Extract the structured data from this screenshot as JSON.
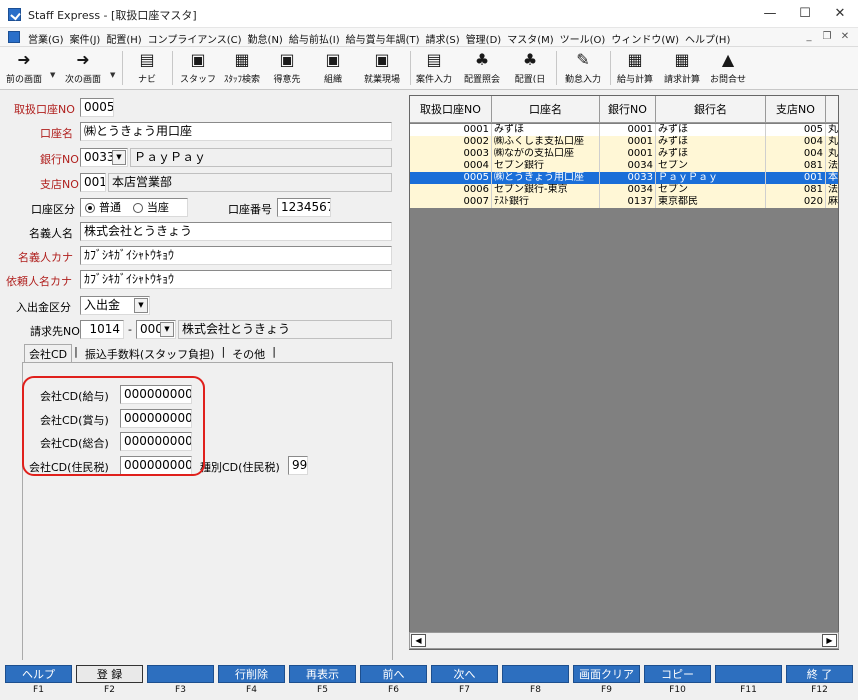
{
  "window": {
    "title": "Staff Express - [取扱口座マスタ]",
    "minimize": "—",
    "maximize": "☐",
    "close": "✕"
  },
  "menu": {
    "items": [
      "営業(G)",
      "案件(J)",
      "配置(H)",
      "コンプライアンス(C)",
      "勤怠(N)",
      "給与前払(I)",
      "給与賞与年調(T)",
      "請求(S)",
      "管理(D)",
      "マスタ(M)",
      "ツール(O)",
      "ウィンドウ(W)",
      "ヘルプ(H)"
    ],
    "mdi_minimize": "_",
    "mdi_restore": "❐",
    "mdi_close": "✕"
  },
  "toolbar": {
    "prev": "前の画面",
    "next": "次の画面",
    "navi": "ナビ",
    "staff": "スタッフ",
    "staff_search": "ｽﾀｯﾌ検索",
    "client": "得意先",
    "org": "組織",
    "workplace": "就業現場",
    "job_entry": "案件入力",
    "assign_inquiry": "配置照会",
    "assign_day": "配置(日",
    "attendance": "勤怠入力",
    "payroll": "給与計算",
    "billing": "請求計算",
    "inquiry": "お問合せ"
  },
  "form": {
    "account_no_label": "取扱口座NO",
    "account_no": "0005",
    "account_name_label": "口座名",
    "account_name": "㈱とうきょう用口座",
    "bank_no_label": "銀行NO",
    "bank_no": "0033",
    "bank_name": "ＰａｙＰａｙ",
    "branch_no_label": "支店NO",
    "branch_no": "001",
    "branch_name": "本店営業部",
    "account_type_label": "口座区分",
    "account_type_opt1": "普通",
    "account_type_opt2": "当座",
    "account_number_label": "口座番号",
    "account_number": "1234567",
    "holder_name_label": "名義人名",
    "holder_name": "株式会社とうきょう",
    "holder_kana_label": "名義人カナ",
    "holder_kana": "ｶﾌﾞｼｷｶﾞｲｼｬﾄｳｷｮｳ",
    "requester_kana_label": "依頼人名カナ",
    "requester_kana": "ｶﾌﾞｼｷｶﾞｲｼｬﾄｳｷｮｳ",
    "inout_label": "入出金区分",
    "inout_value": "入出金",
    "billing_to_label": "請求先NO",
    "billing_to_no": "1014",
    "billing_to_dash": "-",
    "billing_to_sub": "000",
    "billing_to_name": "株式会社とうきょう"
  },
  "tabs": {
    "tab1": "会社CD",
    "tab2": "振込手数料(スタッフ負担)",
    "tab3": "その他",
    "sep": "|"
  },
  "company_cd": {
    "salary_label": "会社CD(給与)",
    "salary": "0000000000",
    "bonus_label": "会社CD(賞与)",
    "bonus": "0000000000",
    "total_label": "会社CD(総合)",
    "total": "0000000000",
    "resident_label": "会社CD(住民税)",
    "resident": "0000000000",
    "type_label": "種別CD(住民税)",
    "type_value": "99"
  },
  "grid": {
    "headers": [
      "取扱口座NO",
      "口座名",
      "銀行NO",
      "銀行名",
      "支店NO"
    ],
    "rows": [
      [
        "0001",
        "みずほ",
        "0001",
        "みずほ",
        "005",
        "丸之"
      ],
      [
        "0002",
        "㈱ふくしま支払口座",
        "0001",
        "みずほ",
        "004",
        "丸の"
      ],
      [
        "0003",
        "㈱ながの支払口座",
        "0001",
        "みずほ",
        "004",
        "丸の"
      ],
      [
        "0004",
        "セブン銀行",
        "0034",
        "セブン",
        "081",
        "法人"
      ],
      [
        "0005",
        "㈱とうきょう用口座",
        "0033",
        "ＰａｙＰａｙ",
        "001",
        "本店"
      ],
      [
        "0006",
        "セブン銀行-東京",
        "0034",
        "セブン",
        "081",
        "法人"
      ],
      [
        "0007",
        "ﾃｽﾄ銀行",
        "0137",
        "東京都民",
        "020",
        "麻布"
      ]
    ]
  },
  "fkeys": {
    "f1": "ヘルプ",
    "f2": "登 録",
    "f3": "",
    "f4": "行削除",
    "f5": "再表示",
    "f6": "前へ",
    "f7": "次へ",
    "f8": "",
    "f9": "画面クリア",
    "f10": "コピー",
    "f11": "",
    "f12": "終 了",
    "l1": "F1",
    "l2": "F2",
    "l3": "F3",
    "l4": "F4",
    "l5": "F5",
    "l6": "F6",
    "l7": "F7",
    "l8": "F8",
    "l9": "F9",
    "l10": "F10",
    "l11": "F11",
    "l12": "F12"
  }
}
